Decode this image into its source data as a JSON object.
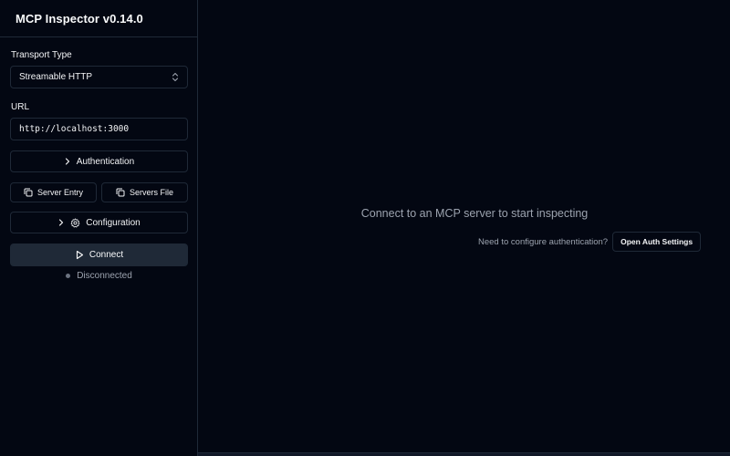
{
  "app": {
    "title": "MCP Inspector v0.14.0"
  },
  "sidebar": {
    "transport_label": "Transport Type",
    "transport_value": "Streamable HTTP",
    "url_label": "URL",
    "url_value": "http://localhost:3000",
    "authentication_label": "Authentication",
    "server_entry_label": "Server Entry",
    "servers_file_label": "Servers File",
    "configuration_label": "Configuration",
    "connect_label": "Connect",
    "status_text": "Disconnected"
  },
  "main": {
    "empty_message": "Connect to an MCP server to start inspecting",
    "auth_hint": "Need to configure authentication?",
    "open_auth_label": "Open Auth Settings"
  },
  "colors": {
    "background": "#030712",
    "border": "#1f2937",
    "connect_button": "#1f2937",
    "muted_text": "#9ca3af",
    "status_dot": "#6b7280"
  },
  "icons": {
    "transport_select": "chevrons-up-down-icon",
    "authentication": "chevron-right-icon",
    "server_entry": "copy-icon",
    "servers_file": "copy-icon",
    "configuration": "gear-icon",
    "connect": "play-icon"
  }
}
